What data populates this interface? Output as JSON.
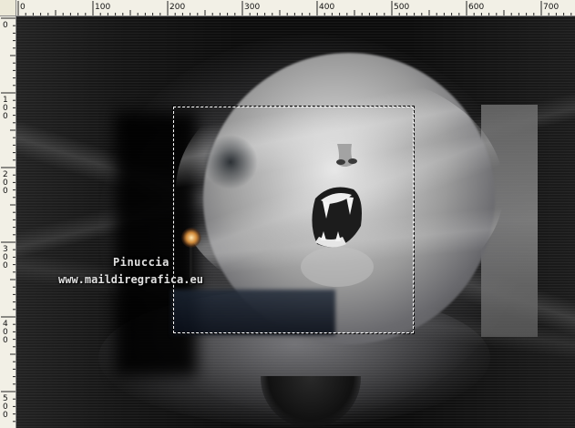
{
  "rulers": {
    "top_labels": [
      "0",
      "100",
      "200",
      "300",
      "400",
      "500",
      "600",
      "700"
    ],
    "left_labels": [
      "0",
      "100",
      "200",
      "300",
      "400",
      "500"
    ]
  },
  "watermark": {
    "name": "Pinuccia",
    "url": "www.maildiregrafica.eu"
  },
  "colors": {
    "ruler_bg": "#f2f0e6",
    "canvas_bg": "#070707",
    "selection": "#ffffff"
  }
}
